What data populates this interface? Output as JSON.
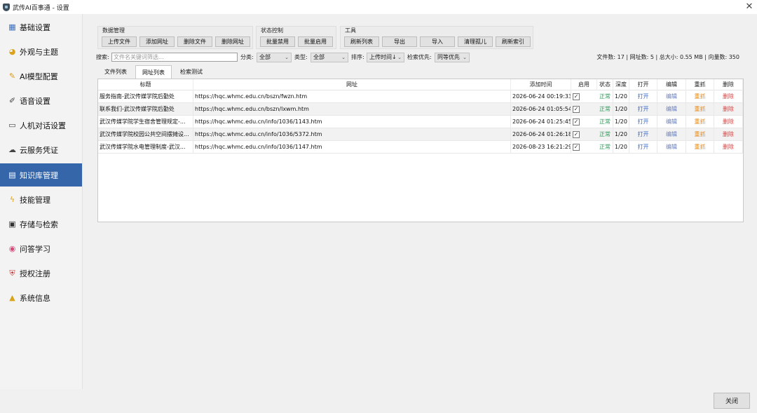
{
  "window": {
    "title": "武传AI百事通 - 设置",
    "close_glyph": "✕"
  },
  "sidebar": {
    "items": [
      {
        "label": "基础设置",
        "icon": "chart-icon",
        "glyph": "▦"
      },
      {
        "label": "外观与主题",
        "icon": "palette-icon",
        "glyph": "◕"
      },
      {
        "label": "AI模型配置",
        "icon": "wrench-icon",
        "glyph": "✎"
      },
      {
        "label": "语音设置",
        "icon": "pen-icon",
        "glyph": "✐"
      },
      {
        "label": "人机对话设置",
        "icon": "chat-icon",
        "glyph": "▭"
      },
      {
        "label": "云服务凭证",
        "icon": "cloud-icon",
        "glyph": "☁"
      },
      {
        "label": "知识库管理",
        "icon": "book-icon",
        "glyph": "▤"
      },
      {
        "label": "技能管理",
        "icon": "lightning-icon",
        "glyph": "ϟ"
      },
      {
        "label": "存储与检索",
        "icon": "save-icon",
        "glyph": "▣"
      },
      {
        "label": "问答学习",
        "icon": "brain-icon",
        "glyph": "◉"
      },
      {
        "label": "授权注册",
        "icon": "shield-icon",
        "glyph": "⛨"
      },
      {
        "label": "系统信息",
        "icon": "lock-icon",
        "glyph": "▲"
      }
    ],
    "active_index": 6
  },
  "toolbar": {
    "data_group": {
      "label": "数据管理",
      "buttons": [
        "上传文件",
        "添加网址",
        "删除文件",
        "删除网址"
      ]
    },
    "status_group": {
      "label": "状态控制",
      "buttons": [
        "批量禁用",
        "批量启用"
      ]
    },
    "tools_group": {
      "label": "工具",
      "buttons": [
        "刷新列表",
        "导出",
        "导入",
        "清理孤儿",
        "刷新索引"
      ]
    }
  },
  "filters": {
    "search_label": "搜索:",
    "search_placeholder": "文件名关键词筛选...",
    "category_label": "分类:",
    "category_value": "全部",
    "type_label": "类型:",
    "type_value": "全部",
    "sort_label": "排序:",
    "sort_value": "上传时间↓",
    "priority_label": "检索优先:",
    "priority_value": "同等优先",
    "stats": "文件数: 17 | 网址数: 5 | 总大小: 0.55 MB | 向量数: 350"
  },
  "tabs": [
    "文件列表",
    "网址列表",
    "检索测试"
  ],
  "active_tab": 1,
  "table": {
    "columns": [
      "标题",
      "网址",
      "添加时间",
      "启用",
      "状态",
      "深度",
      "打开",
      "编辑",
      "重抓",
      "删除"
    ],
    "rows": [
      {
        "title": "服务指南-武汉传媒学院后勤处",
        "url": "https://hqc.whmc.edu.cn/bszn/fwzn.htm",
        "time": "2026-06-24 00:19:33",
        "enabled": true,
        "status": "正常",
        "depth": "1/20",
        "open": "打开",
        "edit": "编辑",
        "rescan": "重抓",
        "delete": "删除"
      },
      {
        "title": "联系我们-武汉传媒学院后勤处",
        "url": "https://hqc.whmc.edu.cn/bszn/lxwm.htm",
        "time": "2026-06-24 01:05:54",
        "enabled": true,
        "status": "正常",
        "depth": "1/20",
        "open": "打开",
        "edit": "编辑",
        "rescan": "重抓",
        "delete": "删除"
      },
      {
        "title": "武汉传媒学院学生宿舍管理规定-...",
        "url": "https://hqc.whmc.edu.cn/info/1036/1143.htm",
        "time": "2026-06-24 01:25:45",
        "enabled": true,
        "status": "正常",
        "depth": "1/20",
        "open": "打开",
        "edit": "编辑",
        "rescan": "重抓",
        "delete": "删除"
      },
      {
        "title": "武汉传媒学院校园公共空间摆摊设...",
        "url": "https://hqc.whmc.edu.cn/info/1036/5372.htm",
        "time": "2026-06-24 01:26:18",
        "enabled": true,
        "status": "正常",
        "depth": "1/20",
        "open": "打开",
        "edit": "编辑",
        "rescan": "重抓",
        "delete": "删除"
      },
      {
        "title": "武汉传媒学院水电管理制度-武汉...",
        "url": "https://hqc.whmc.edu.cn/info/1036/1147.htm",
        "time": "2026-08-23 16:21:29",
        "enabled": true,
        "status": "正常",
        "depth": "1/20",
        "open": "打开",
        "edit": "编辑",
        "rescan": "重抓",
        "delete": "删除"
      }
    ]
  },
  "footer": {
    "close_label": "关闭"
  },
  "colors": {
    "accent": "#3566a9",
    "status_ok": "#2e9b5a",
    "link_open": "#3a68c4",
    "link_rescan": "#e08a1e",
    "link_delete": "#d8413f"
  }
}
